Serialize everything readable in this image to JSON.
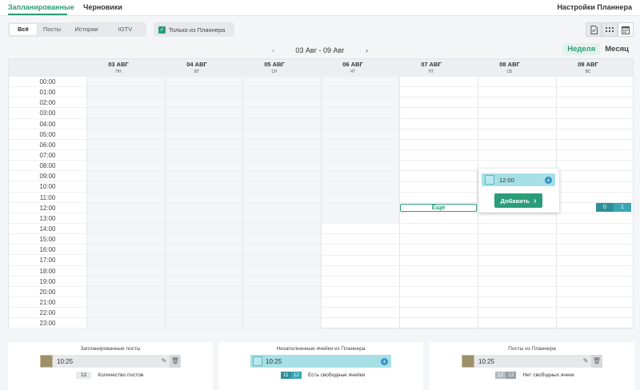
{
  "tabs": {
    "scheduled": "Запланированные",
    "drafts": "Черновики"
  },
  "planner_settings": "Настройки Планнера",
  "filters": [
    {
      "label": "Всё",
      "active": true
    },
    {
      "label": "Посты",
      "active": false
    },
    {
      "label": "Истории",
      "active": false
    },
    {
      "label": "IGTV",
      "active": false
    }
  ],
  "only_planner": {
    "label": "Только из Планнера",
    "checked": true
  },
  "view_icons": [
    "document-icon",
    "grid-icon",
    "calendar-icon"
  ],
  "date_range": "03 Авг - 09 Авг",
  "views": {
    "week": "Неделя",
    "month": "Месяц",
    "selected": "week"
  },
  "days": [
    {
      "date": "03 АВГ",
      "weekday": "ПН"
    },
    {
      "date": "04 АВГ",
      "weekday": "ВТ"
    },
    {
      "date": "05 АВГ",
      "weekday": "СР"
    },
    {
      "date": "06 АВГ",
      "weekday": "ЧТ"
    },
    {
      "date": "07 АВГ",
      "weekday": "ПТ"
    },
    {
      "date": "08 АВГ",
      "weekday": "СБ"
    },
    {
      "date": "09 АВГ",
      "weekday": "ВС"
    }
  ],
  "hours": [
    "00:00",
    "01:00",
    "02:00",
    "03:00",
    "04:00",
    "05:00",
    "06:00",
    "07:00",
    "08:00",
    "09:00",
    "10:00",
    "11:00",
    "12:00",
    "13:00",
    "14:00",
    "15:00",
    "16:00",
    "17:00",
    "18:00",
    "19:00",
    "20:00",
    "21:00",
    "22:00",
    "23:00"
  ],
  "more_label": "Еще",
  "popup": {
    "time": "12:00",
    "add_label": "Добавить"
  },
  "counters": [
    "0",
    "1"
  ],
  "legend": {
    "scheduled": {
      "title": "Запланированные посты",
      "time": "10:25",
      "count": "12",
      "count_label": "Количество постов"
    },
    "empty": {
      "title": "Незаполненные ячейки из Планнера",
      "time": "10:25",
      "a": "11",
      "b": "12",
      "label": "Есть свободные ячейки"
    },
    "planner": {
      "title": "Посты из Планнера",
      "time": "10:25",
      "a": "12",
      "b": "12",
      "label": "Нет свободных ячеек"
    }
  },
  "colors": {
    "accent": "#2a9d78",
    "slot": "#a6e0e6",
    "counter": "#2f8f99"
  }
}
